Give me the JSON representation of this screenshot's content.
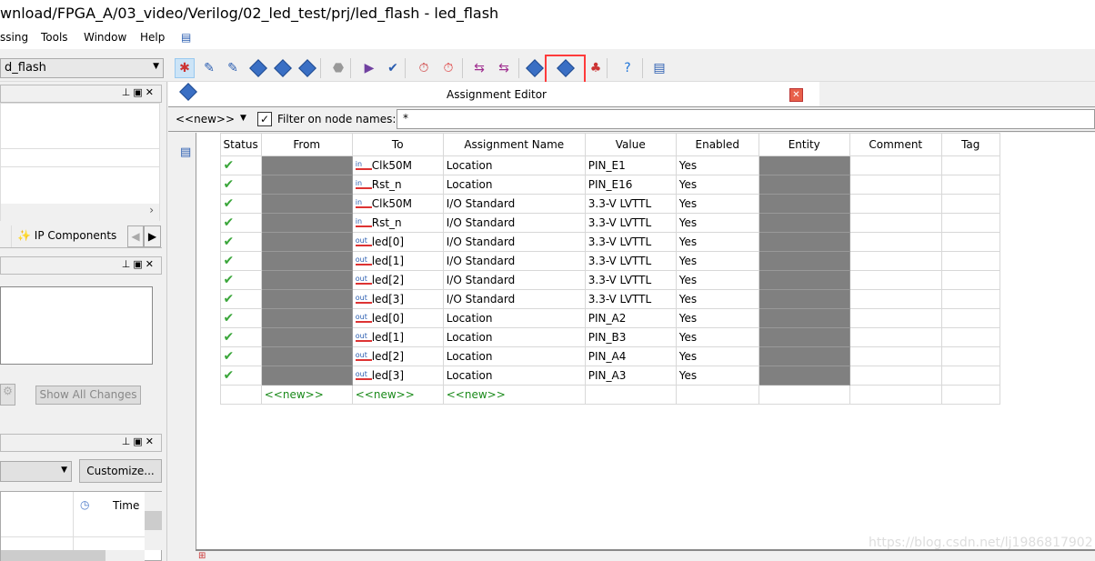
{
  "window": {
    "title": "wnload/FPGA_A/03_video/Verilog/02_led_test/prj/led_flash - led_flash"
  },
  "menu": [
    {
      "label": "ssing"
    },
    {
      "label": "Tools"
    },
    {
      "label": "Window"
    },
    {
      "label": "Help"
    }
  ],
  "toolbar": {
    "project_select": "d_flash",
    "highlighted_icon": "pin-planner-icon",
    "highlight_color": "#ff3b3b",
    "icons": [
      "compilation-report-icon",
      "pin-assign-icon",
      "edit-icon",
      "analysis-icon",
      "synthesis-icon",
      "fitter-icon",
      "stop-icon",
      "start-icon",
      "compile-icon",
      "timing-analyzer-icon",
      "timing-icon",
      "rtl-viewer-icon",
      "tech-map-icon",
      "chip-planner-icon",
      "pin-planner-icon",
      "programmer-icon",
      "help-icon",
      "feedback-icon"
    ]
  },
  "left": {
    "tabs": {
      "ip_components": "IP Components"
    },
    "changes": {
      "show_all_changes": "Show All Changes"
    },
    "messages": {
      "customize": "Customize...",
      "time_col": "Time"
    }
  },
  "editor": {
    "title": "Assignment Editor",
    "filter": {
      "category": "<<new>>",
      "checked": true,
      "label": "Filter on node names:",
      "value": "*"
    },
    "columns": [
      "Status",
      "From",
      "To",
      "Assignment Name",
      "Value",
      "Enabled",
      "Entity",
      "Comment",
      "Tag"
    ],
    "rows": [
      {
        "n": "1",
        "dir": "in",
        "to": "Clk50M",
        "name": "Location",
        "value": "PIN_E1",
        "enabled": "Yes"
      },
      {
        "n": "2",
        "dir": "in",
        "to": "Rst_n",
        "name": "Location",
        "value": "PIN_E16",
        "enabled": "Yes"
      },
      {
        "n": "3",
        "dir": "in",
        "to": "Clk50M",
        "name": "I/O Standard",
        "value": "3.3-V LVTTL",
        "enabled": "Yes"
      },
      {
        "n": "4",
        "dir": "in",
        "to": "Rst_n",
        "name": "I/O Standard",
        "value": "3.3-V LVTTL",
        "enabled": "Yes"
      },
      {
        "n": "5",
        "dir": "out",
        "to": "led[0]",
        "name": "I/O Standard",
        "value": "3.3-V LVTTL",
        "enabled": "Yes"
      },
      {
        "n": "6",
        "dir": "out",
        "to": "led[1]",
        "name": "I/O Standard",
        "value": "3.3-V LVTTL",
        "enabled": "Yes"
      },
      {
        "n": "7",
        "dir": "out",
        "to": "led[2]",
        "name": "I/O Standard",
        "value": "3.3-V LVTTL",
        "enabled": "Yes"
      },
      {
        "n": "8",
        "dir": "out",
        "to": "led[3]",
        "name": "I/O Standard",
        "value": "3.3-V LVTTL",
        "enabled": "Yes"
      },
      {
        "n": "9",
        "dir": "out",
        "to": "led[0]",
        "name": "Location",
        "value": "PIN_A2",
        "enabled": "Yes"
      },
      {
        "n": "10",
        "dir": "out",
        "to": "led[1]",
        "name": "Location",
        "value": "PIN_B3",
        "enabled": "Yes"
      },
      {
        "n": "11",
        "dir": "out",
        "to": "led[2]",
        "name": "Location",
        "value": "PIN_A4",
        "enabled": "Yes"
      },
      {
        "n": "12",
        "dir": "out",
        "to": "led[3]",
        "name": "Location",
        "value": "PIN_A3",
        "enabled": "Yes"
      }
    ],
    "new_row": {
      "n": "13",
      "from": "<<new>>",
      "to": "<<new>>",
      "name": "<<new>>"
    }
  },
  "watermark": "https://blog.csdn.net/lj1986817902"
}
